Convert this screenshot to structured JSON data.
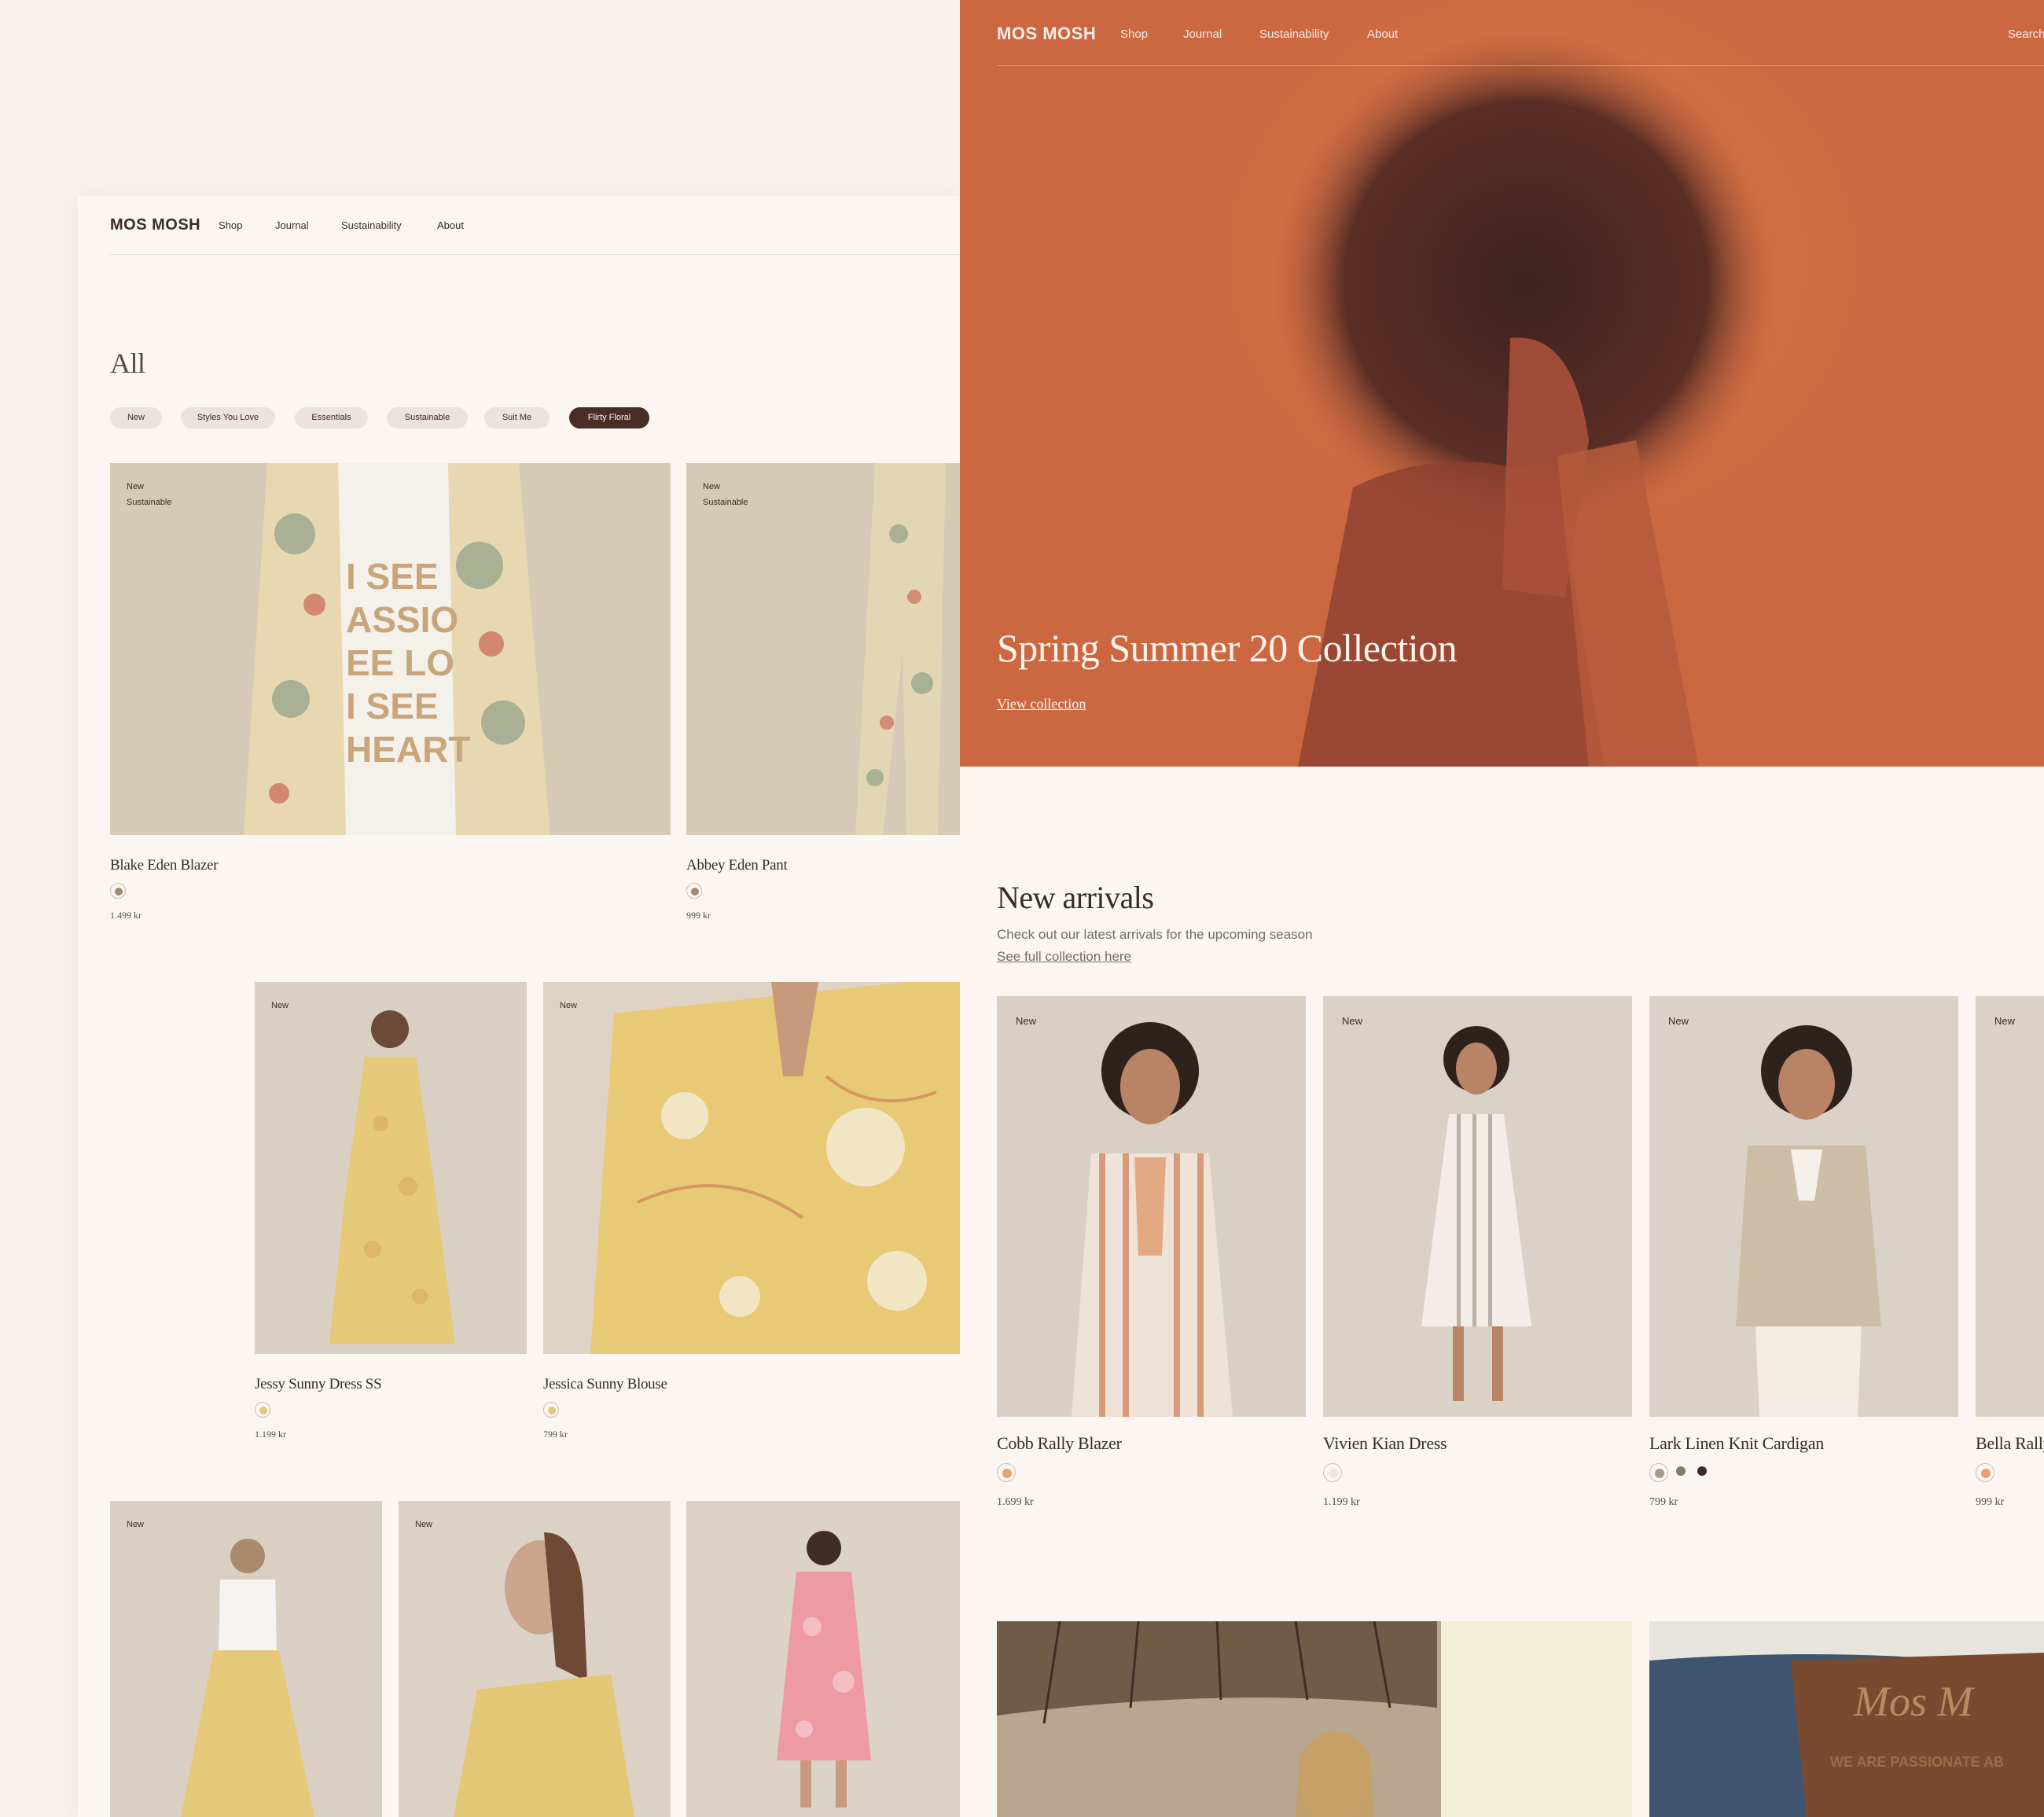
{
  "brand": "MOS MOSH",
  "nav": [
    "Shop",
    "Journal",
    "Sustainability",
    "About"
  ],
  "search_label": "Search",
  "left": {
    "page_title": "All",
    "chips": [
      {
        "label": "New",
        "active": false
      },
      {
        "label": "Styles You Love",
        "active": false
      },
      {
        "label": "Essentials",
        "active": false
      },
      {
        "label": "Sustainable",
        "active": false
      },
      {
        "label": "Suit Me",
        "active": false
      },
      {
        "label": "Flirty Floral",
        "active": true
      }
    ],
    "products": [
      {
        "name": "Blake Eden Blazer",
        "price": "1.499 kr",
        "badges": [
          "New",
          "Sustainable"
        ],
        "swatches": [
          "#9d8a7a"
        ]
      },
      {
        "name": "Abbey Eden Pant",
        "price": "999 kr",
        "badges": [
          "New",
          "Sustainable"
        ],
        "swatches": [
          "#9d8a7a"
        ]
      },
      {
        "name": "Jessy Sunny Dress SS",
        "price": "1.199 kr",
        "badges": [
          "New"
        ],
        "swatches": [
          "#e2c67c"
        ]
      },
      {
        "name": "Jessica Sunny Blouse",
        "price": "799 kr",
        "badges": [
          "New"
        ],
        "swatches": [
          "#e2c67c"
        ]
      },
      {
        "name": "",
        "price": "",
        "badges": [
          "New"
        ],
        "swatches": []
      },
      {
        "name": "",
        "price": "",
        "badges": [
          "New"
        ],
        "swatches": []
      },
      {
        "name": "",
        "price": "",
        "badges": [],
        "swatches": []
      }
    ]
  },
  "right": {
    "hero": {
      "title": "Spring Summer 20 Collection",
      "link": "View collection"
    },
    "new_arrivals": {
      "title": "New arrivals",
      "subtitle": "Check out our latest arrivals for the upcoming season",
      "link": "See full collection here"
    },
    "products": [
      {
        "name": "Cobb Rally Blazer",
        "price": "1.699 kr",
        "badge": "New",
        "swatches": [
          "#e9a070"
        ]
      },
      {
        "name": "Vivien Kian Dress",
        "price": "1.199 kr",
        "badge": "New",
        "swatches": [
          "#efe6dc"
        ]
      },
      {
        "name": "Lark Linen Knit Cardigan",
        "price": "799 kr",
        "badge": "New",
        "swatches": [
          "#a79a8a",
          "#7b8461",
          "#3e2a2e"
        ]
      },
      {
        "name": "Bella Rally",
        "price": "999 kr",
        "badge": "New",
        "swatches": [
          "#e9a070"
        ]
      }
    ]
  },
  "colors": {
    "page_bg": "#f6f1ec",
    "panel_bg": "#fcf6f2",
    "text": "#3a2c26",
    "chip_bg": "#ece3dc",
    "chip_active": "#4a2e26",
    "hero_orange": "#cc6440"
  }
}
